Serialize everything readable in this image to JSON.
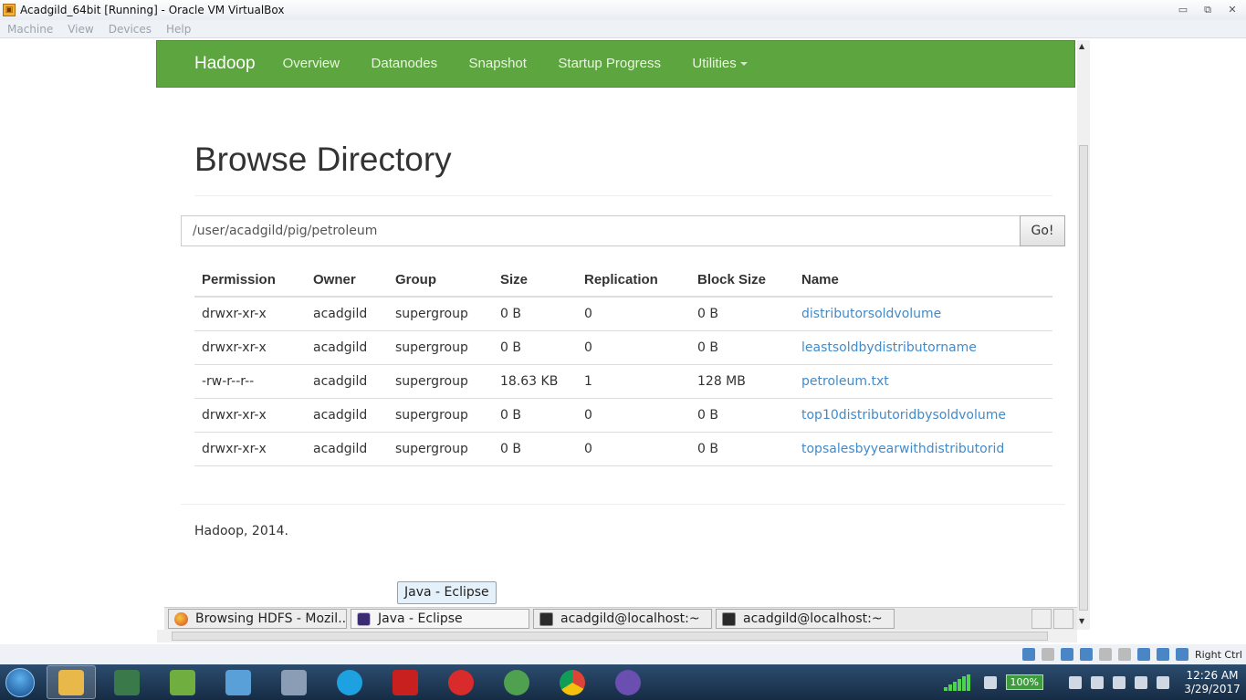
{
  "window": {
    "title": "Acadgild_64bit [Running] - Oracle VM VirtualBox",
    "min_glyph": "▭",
    "max_glyph": "⧉",
    "close_glyph": "✕"
  },
  "menu": {
    "items": [
      "Machine",
      "View",
      "Devices",
      "Help"
    ]
  },
  "hadoop": {
    "brand": "Hadoop",
    "nav": [
      "Overview",
      "Datanodes",
      "Snapshot",
      "Startup Progress",
      "Utilities"
    ],
    "heading": "Browse Directory",
    "path": "/user/acadgild/pig/petroleum",
    "go_label": "Go!",
    "columns": [
      "Permission",
      "Owner",
      "Group",
      "Size",
      "Replication",
      "Block Size",
      "Name"
    ],
    "rows": [
      [
        "drwxr-xr-x",
        "acadgild",
        "supergroup",
        "0 B",
        "0",
        "0 B",
        "distributorsoldvolume"
      ],
      [
        "drwxr-xr-x",
        "acadgild",
        "supergroup",
        "0 B",
        "0",
        "0 B",
        "leastsoldbydistributorname"
      ],
      [
        "-rw-r--r--",
        "acadgild",
        "supergroup",
        "18.63 KB",
        "1",
        "128 MB",
        "petroleum.txt"
      ],
      [
        "drwxr-xr-x",
        "acadgild",
        "supergroup",
        "0 B",
        "0",
        "0 B",
        "top10distributoridbysoldvolume"
      ],
      [
        "drwxr-xr-x",
        "acadgild",
        "supergroup",
        "0 B",
        "0",
        "0 B",
        "topsalesbyyearwithdistributorid"
      ]
    ],
    "footer": "Hadoop, 2014."
  },
  "tooltip": "Java - Eclipse",
  "guest_taskbar": [
    {
      "label": "Browsing HDFS - Mozil...",
      "icon": "firefox-icon"
    },
    {
      "label": "Java - Eclipse",
      "icon": "eclipse-icon"
    },
    {
      "label": "acadgild@localhost:~",
      "icon": "terminal-icon"
    },
    {
      "label": "acadgild@localhost:~",
      "icon": "terminal-icon"
    }
  ],
  "status": {
    "host_key": "Right Ctrl"
  },
  "host_taskbar": {
    "battery": "100%",
    "time": "12:26 AM",
    "date": "3/29/2017"
  },
  "colors": {
    "navbar": "#5da53e",
    "link": "#428bca",
    "taskbar": "#1f3a58"
  }
}
